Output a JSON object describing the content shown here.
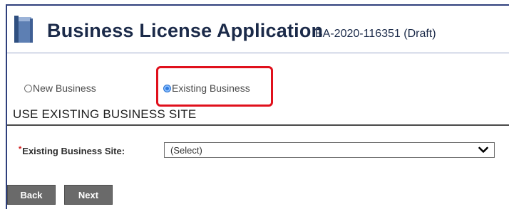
{
  "header": {
    "icon": "binder-icon",
    "title": "Business License Application",
    "application_id": "BA-2020-116351 (Draft)"
  },
  "business_type": {
    "options": [
      {
        "label": "New Business",
        "selected": false
      },
      {
        "label": "Existing Business",
        "selected": true
      }
    ]
  },
  "section": {
    "title": "USE EXISTING BUSINESS SITE"
  },
  "form": {
    "site_label": "Existing Business Site:",
    "site_required_marker": "*",
    "site_value": "(Select)",
    "dropdown_icon": "chevron-down-icon"
  },
  "buttons": {
    "back": "Back",
    "next": "Next"
  },
  "colors": {
    "highlight": "#e0101c",
    "header_text": "#1b2a49",
    "button_bg": "#6a6a6a",
    "radio_selected": "#2f7be0"
  }
}
